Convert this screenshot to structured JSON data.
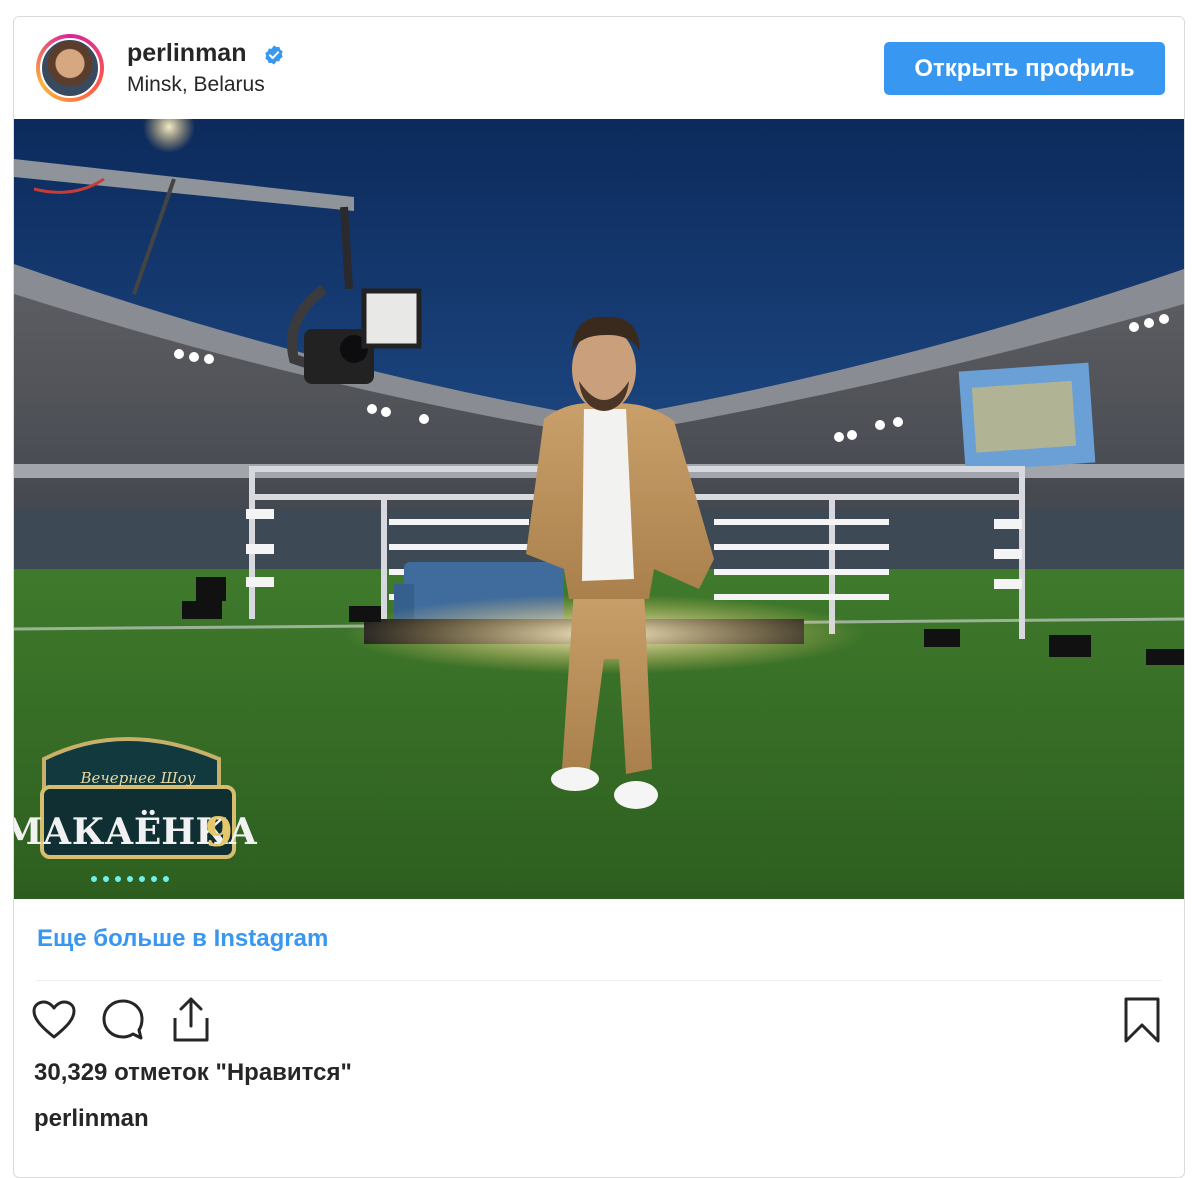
{
  "post": {
    "username": "perlinman",
    "location": "Minsk, Belarus",
    "verified": true,
    "open_profile_label": "Открыть профиль",
    "more_link": "Еще больше в Instagram",
    "likes_text": "30,329 отметок \"Нравится\"",
    "caption_username": "perlinman"
  },
  "photo": {
    "logo_text": "МАКАЁНКА",
    "logo_number": "9",
    "logo_script": "Вечернее Шоу"
  },
  "colors": {
    "accent": "#3897f0",
    "text": "#262626",
    "border": "#dbdbdb"
  },
  "icons": {
    "like": "heart-icon",
    "comment": "comment-icon",
    "share": "share-icon",
    "save": "bookmark-icon",
    "verified": "verified-badge-icon"
  }
}
